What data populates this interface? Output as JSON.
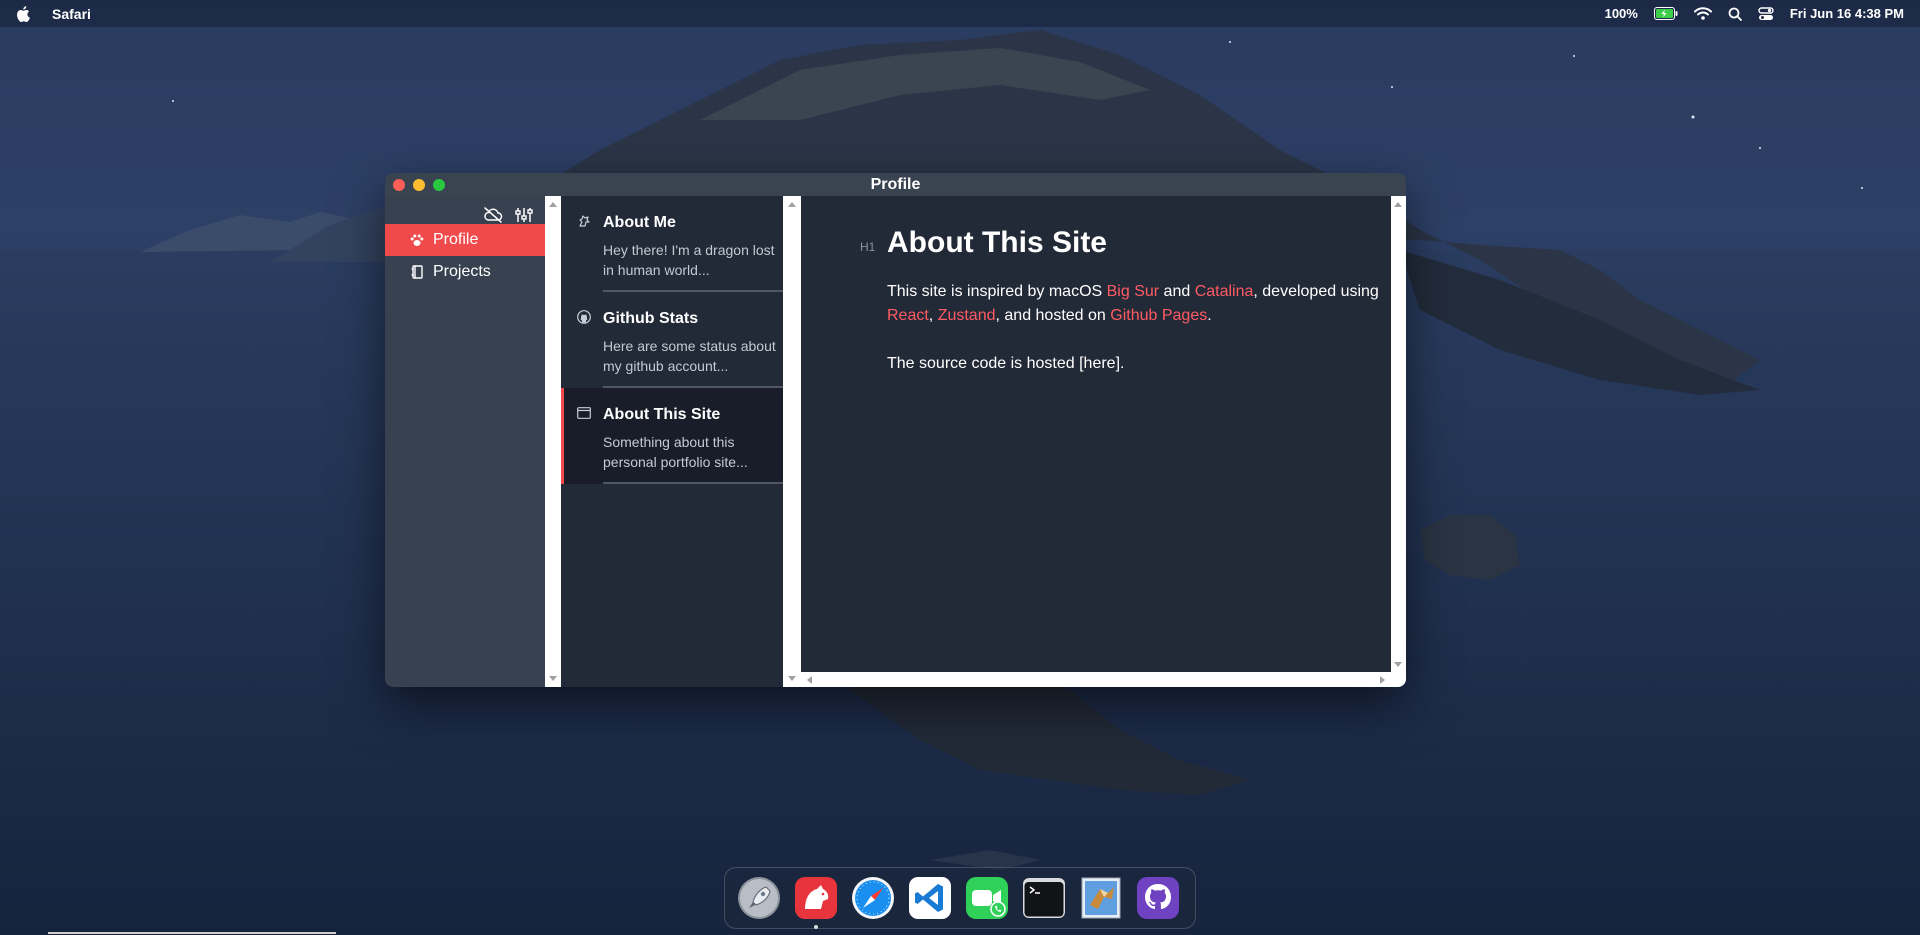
{
  "menubar": {
    "app_name": "Safari",
    "battery_percent": "100%",
    "datetime": "Fri Jun 16 4:38 PM",
    "icons": [
      "apple-icon",
      "battery-charging-icon",
      "wifi-icon",
      "search-icon",
      "control-center-icon"
    ]
  },
  "window": {
    "title": "Profile",
    "toolbar_icons": [
      "cloud-off-icon",
      "sliders-icon"
    ]
  },
  "sidebar": {
    "items": [
      {
        "label": "Profile",
        "icon": "paw-icon",
        "active": true
      },
      {
        "label": "Projects",
        "icon": "notebook-icon",
        "active": false
      }
    ]
  },
  "notes": [
    {
      "title": "About Me",
      "excerpt": "Hey there! I'm a dragon lost in human world...",
      "icon": "dragon-icon",
      "active": false
    },
    {
      "title": "Github Stats",
      "excerpt": "Here are some status about my github account...",
      "icon": "github-icon",
      "active": false
    },
    {
      "title": "About This Site",
      "excerpt": "Something about this personal portfolio site...",
      "icon": "window-icon",
      "active": true
    }
  ],
  "editor": {
    "heading_tag": "H1",
    "heading": "About This Site",
    "p1": {
      "t1": "This site is inspired by macOS ",
      "link1": "Big Sur",
      "t2": " and ",
      "link2": "Catalina",
      "t3": ", developed using ",
      "link3": "React",
      "t4": ", ",
      "link4": "Zustand",
      "t5": ", and hosted on ",
      "link5": "Github Pages",
      "t6": "."
    },
    "p2": "The source code is hosted [here].",
    "link_color": "#ff5b63"
  },
  "dock": {
    "apps": [
      "launchpad-icon",
      "bear-notes-icon",
      "safari-icon",
      "vscode-icon",
      "facetime-icon",
      "terminal-icon",
      "mail-icon",
      "github-icon"
    ],
    "running": [
      "bear-notes-icon"
    ]
  },
  "colors": {
    "accent": "#f04a4c",
    "sidebar_bg": "#38414f",
    "list_bg": "#222937"
  }
}
